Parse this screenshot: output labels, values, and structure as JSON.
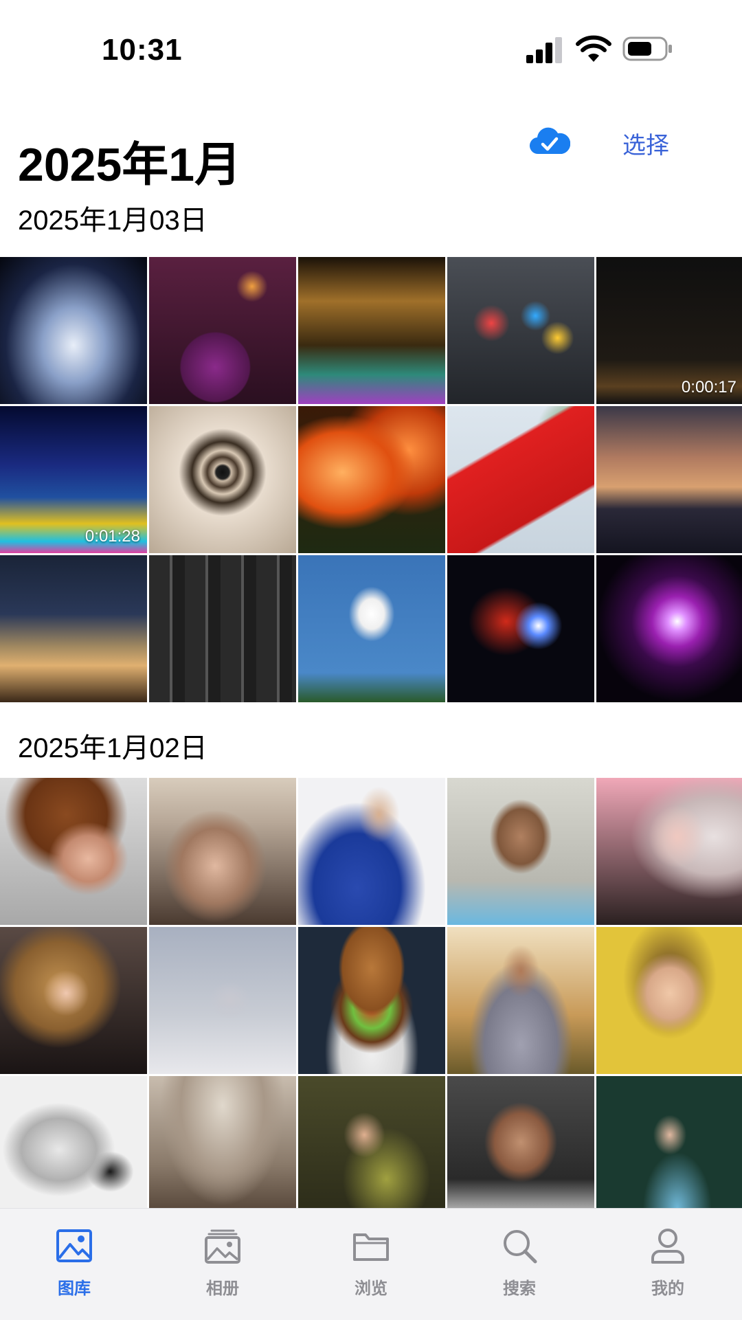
{
  "status_bar": {
    "time": "10:31"
  },
  "header": {
    "month_title": "2025年1月",
    "select_label": "选择",
    "cloud_icon": "cloud-check-icon",
    "accent": "#3a63d8"
  },
  "sections": [
    {
      "date_label": "2025年1月03日",
      "photos": [
        {
          "subject": "fireworks-fountain"
        },
        {
          "subject": "child-watching-fireworks"
        },
        {
          "subject": "fireworks-over-ice-castle"
        },
        {
          "subject": "colorful-kites"
        },
        {
          "subject": "night-city-video",
          "duration": "0:00:17"
        },
        {
          "subject": "fireworks-ice-festival-video",
          "duration": "0:01:28"
        },
        {
          "subject": "spiral-staircase"
        },
        {
          "subject": "red-lanterns"
        },
        {
          "subject": "chinese-flag"
        },
        {
          "subject": "city-skyline-sunset"
        },
        {
          "subject": "christmas-market"
        },
        {
          "subject": "nas-drive-bays"
        },
        {
          "subject": "white-drone"
        },
        {
          "subject": "horsehead-nebula"
        },
        {
          "subject": "purple-nebula"
        }
      ]
    },
    {
      "date_label": "2025年1月02日",
      "photos": [
        {
          "subject": "curly-hair-portrait"
        },
        {
          "subject": "beanie-portrait"
        },
        {
          "subject": "blue-jacket-portrait"
        },
        {
          "subject": "sunglasses-portrait"
        },
        {
          "subject": "blonde-portrait"
        },
        {
          "subject": "wavy-hair-portrait"
        },
        {
          "subject": "man-with-bicycle"
        },
        {
          "subject": "burger"
        },
        {
          "subject": "gap-hoodie-portrait"
        },
        {
          "subject": "yellow-background-portrait"
        },
        {
          "subject": "bw-earring-portrait"
        },
        {
          "subject": "hat-portrait"
        },
        {
          "subject": "plants-portrait"
        },
        {
          "subject": "dark-hair-portrait"
        },
        {
          "subject": "leaves-portrait"
        }
      ]
    }
  ],
  "tab_bar": {
    "tabs": [
      {
        "label": "图库",
        "icon": "photo-icon",
        "active": true
      },
      {
        "label": "相册",
        "icon": "album-icon",
        "active": false
      },
      {
        "label": "浏览",
        "icon": "folder-icon",
        "active": false
      },
      {
        "label": "搜索",
        "icon": "search-icon",
        "active": false
      },
      {
        "label": "我的",
        "icon": "person-icon",
        "active": false
      }
    ],
    "active_color": "#2a6ee8",
    "inactive_color": "#8e8e93"
  }
}
